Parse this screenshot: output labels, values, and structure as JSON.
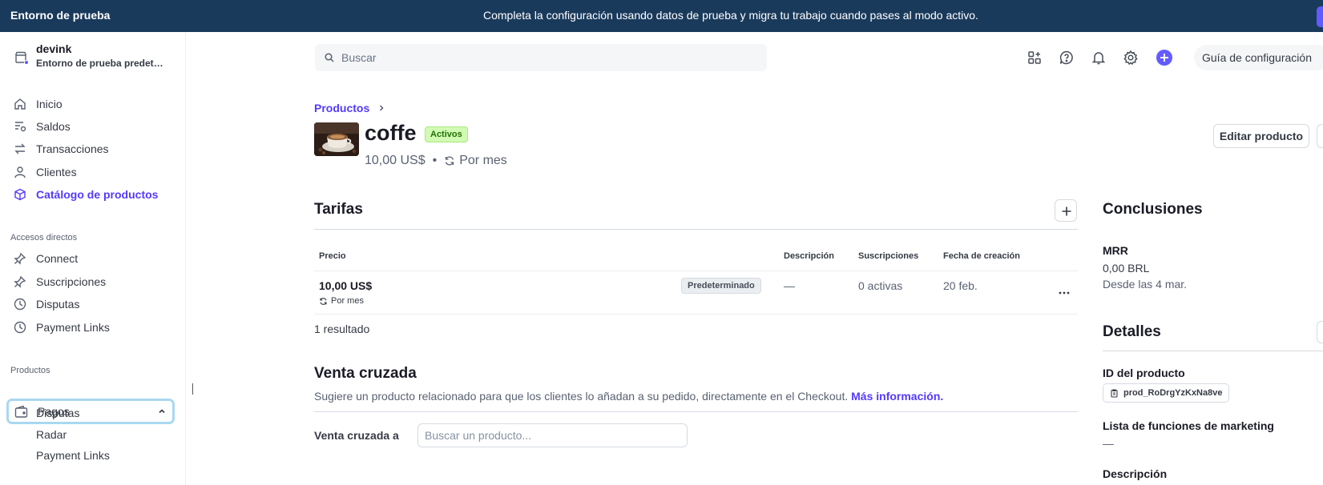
{
  "banner": {
    "environment": "Entorno de prueba",
    "message": "Completa la configuración usando datos de prueba y migra tu trabajo cuando pases al modo activo."
  },
  "account": {
    "name": "devink",
    "subtitle": "Entorno de prueba predet…"
  },
  "nav": {
    "items": [
      {
        "label": "Inicio",
        "icon": "home-icon"
      },
      {
        "label": "Saldos",
        "icon": "balances-icon"
      },
      {
        "label": "Transacciones",
        "icon": "transactions-icon"
      },
      {
        "label": "Clientes",
        "icon": "person-icon"
      },
      {
        "label": "Catálogo de productos",
        "icon": "box-icon",
        "active": true
      }
    ],
    "shortcuts_label": "Accesos directos",
    "shortcuts": [
      {
        "label": "Connect",
        "icon": "pin-icon"
      },
      {
        "label": "Suscripciones",
        "icon": "pin-icon"
      },
      {
        "label": "Disputas",
        "icon": "clock-icon"
      },
      {
        "label": "Payment Links",
        "icon": "clock-icon"
      }
    ],
    "products_label": "Productos",
    "pagos": {
      "label": "Pagos",
      "icon": "wallet-icon",
      "expanded": true
    },
    "pagos_sub": [
      "Disputas",
      "Radar",
      "Payment Links"
    ]
  },
  "header": {
    "search_placeholder": "Buscar",
    "icons": [
      "apps-icon",
      "help-icon",
      "bell-icon",
      "gear-icon",
      "plus-circle-icon"
    ],
    "guide_label": "Guía de configuración"
  },
  "product": {
    "breadcrumb": "Productos",
    "name": "coffe",
    "status": "Activos",
    "price": "10,00 US$",
    "interval": "Por mes",
    "edit_button": "Editar producto"
  },
  "tarifas": {
    "title": "Tarifas",
    "columns": [
      "Precio",
      "Descripción",
      "Suscripciones",
      "Fecha de creación"
    ],
    "rows": [
      {
        "price": "10,00 US$",
        "interval": "Por mes",
        "badge": "Predeterminado",
        "description": "—",
        "subscriptions": "0 activas",
        "created": "20 feb."
      }
    ],
    "results": "1 resultado"
  },
  "cross_sell": {
    "title": "Venta cruzada",
    "description": "Sugiere un producto relacionado para que los clientes lo añadan a su pedido, directamente en el Checkout.",
    "link": "Más información.",
    "field_label": "Venta cruzada a",
    "field_placeholder": "Buscar un producto..."
  },
  "insights": {
    "title": "Conclusiones",
    "metric_label": "MRR",
    "metric_value": "0,00 BRL",
    "metric_since": "Desde las 4 mar."
  },
  "details": {
    "title": "Detalles",
    "id_label": "ID del producto",
    "id_value": "prod_RoDrgYzKxNa8ve",
    "marketing_label": "Lista de funciones de marketing",
    "marketing_value": "—",
    "description_label": "Descripción"
  },
  "colors": {
    "banner": "#1a3a5c",
    "accent": "#533afd",
    "active_badge_bg": "#d1fab3",
    "active_badge_text": "#217005"
  }
}
